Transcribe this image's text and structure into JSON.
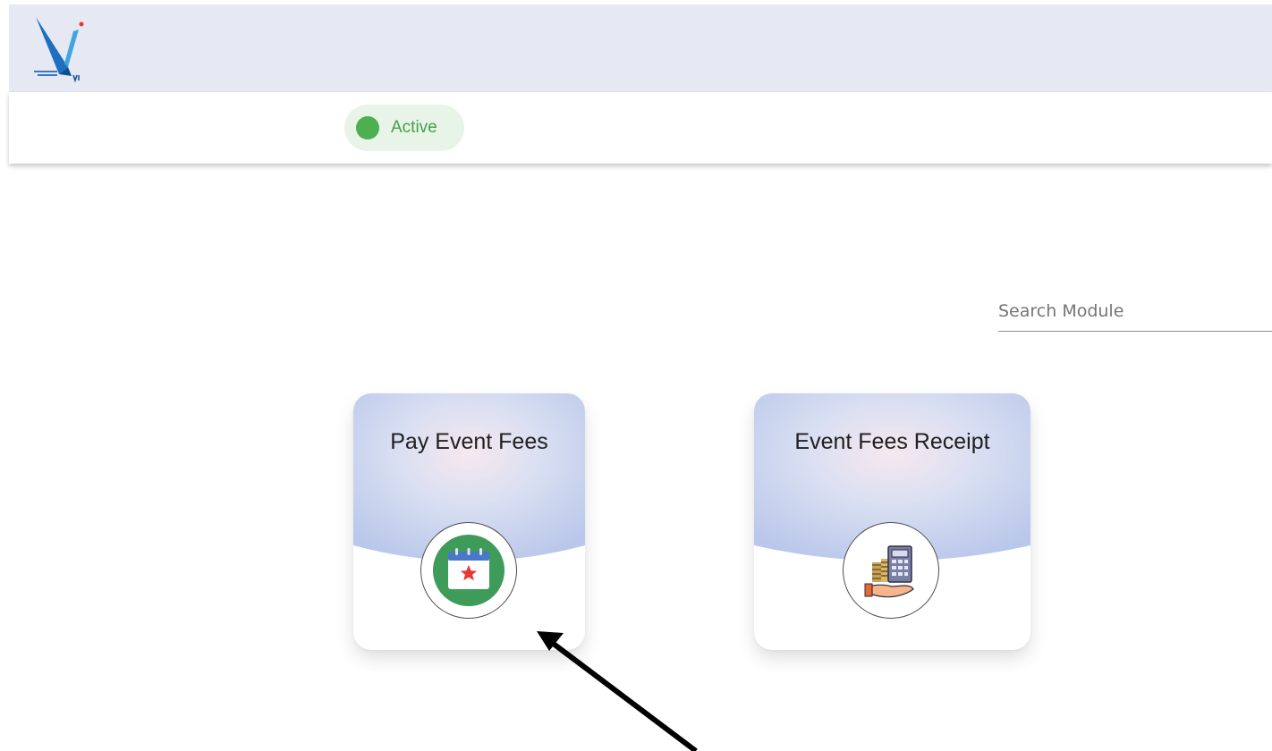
{
  "status": {
    "label": "Active",
    "color": "#4caf50"
  },
  "search": {
    "placeholder": "Search Module",
    "value": ""
  },
  "modules": [
    {
      "title": "Pay Event Fees",
      "icon": "calendar-star-icon"
    },
    {
      "title": "Event Fees Receipt",
      "icon": "calculator-coins-hand-icon"
    }
  ],
  "colors": {
    "header_bg": "#e6e8f4",
    "card_gradient": "#c3cdec",
    "card_glow": "#f6e8ef",
    "status_chip_bg": "#e8f4e8"
  }
}
